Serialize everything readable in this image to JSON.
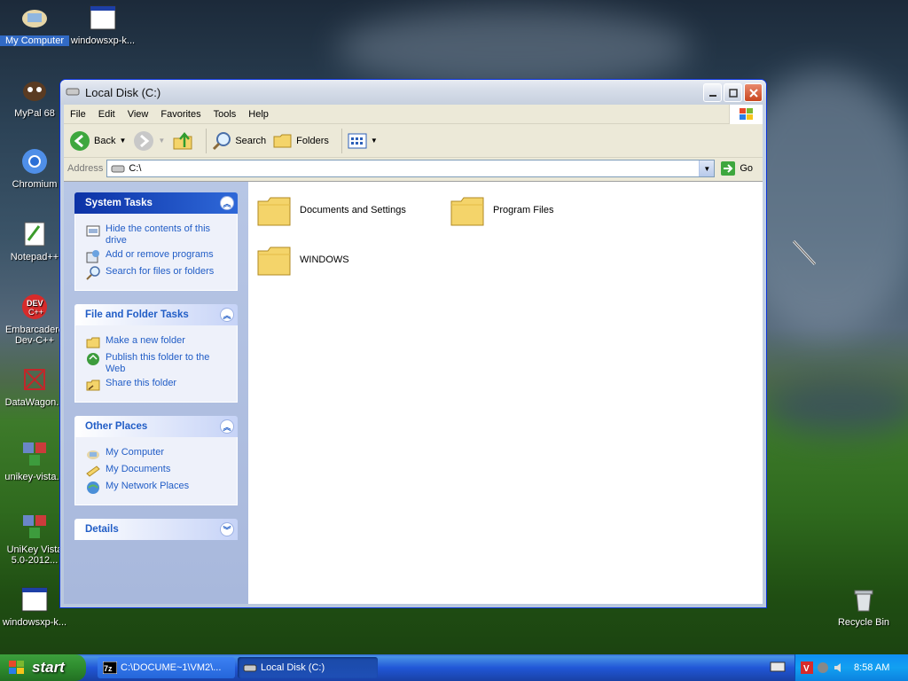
{
  "desktop": {
    "icons": [
      {
        "label": "My Computer",
        "icon": "my-computer-icon"
      },
      {
        "label": "windowsxp-k...",
        "icon": "window-icon"
      },
      {
        "label": "MyPal 68",
        "icon": "mypal-icon"
      },
      {
        "label": "Chromium",
        "icon": "chromium-icon"
      },
      {
        "label": "Notepad++",
        "icon": "notepadpp-icon"
      },
      {
        "label": "Embarcadero Dev-C++",
        "icon": "devcpp-icon"
      },
      {
        "label": "DataWagon...",
        "icon": "datawagon-icon"
      },
      {
        "label": "unikey-vista...",
        "icon": "unikey-icon"
      },
      {
        "label": "UniKey Vista 5.0-2012...",
        "icon": "unikey-icon"
      },
      {
        "label": "windowsxp-k...",
        "icon": "window-icon"
      },
      {
        "label": "Recycle Bin",
        "icon": "recycle-bin-icon"
      }
    ]
  },
  "window": {
    "title": "Local Disk (C:)",
    "menu": [
      "File",
      "Edit",
      "View",
      "Favorites",
      "Tools",
      "Help"
    ],
    "toolbar": {
      "back": "Back",
      "search": "Search",
      "folders": "Folders"
    },
    "address": {
      "label": "Address",
      "value": "C:\\",
      "go": "Go"
    },
    "panels": {
      "system_tasks": {
        "title": "System Tasks",
        "items": [
          "Hide the contents of this drive",
          "Add or remove programs",
          "Search for files or folders"
        ]
      },
      "file_folder_tasks": {
        "title": "File and Folder Tasks",
        "items": [
          "Make a new folder",
          "Publish this folder to the Web",
          "Share this folder"
        ]
      },
      "other_places": {
        "title": "Other Places",
        "items": [
          "My Computer",
          "My Documents",
          "My Network Places"
        ]
      },
      "details": {
        "title": "Details"
      }
    },
    "folders": [
      "Documents and Settings",
      "Program Files",
      "WINDOWS"
    ]
  },
  "taskbar": {
    "start": "start",
    "tasks": [
      "C:\\DOCUME~1\\VM2\\...",
      "Local Disk (C:)"
    ],
    "clock": "8:58 AM"
  }
}
